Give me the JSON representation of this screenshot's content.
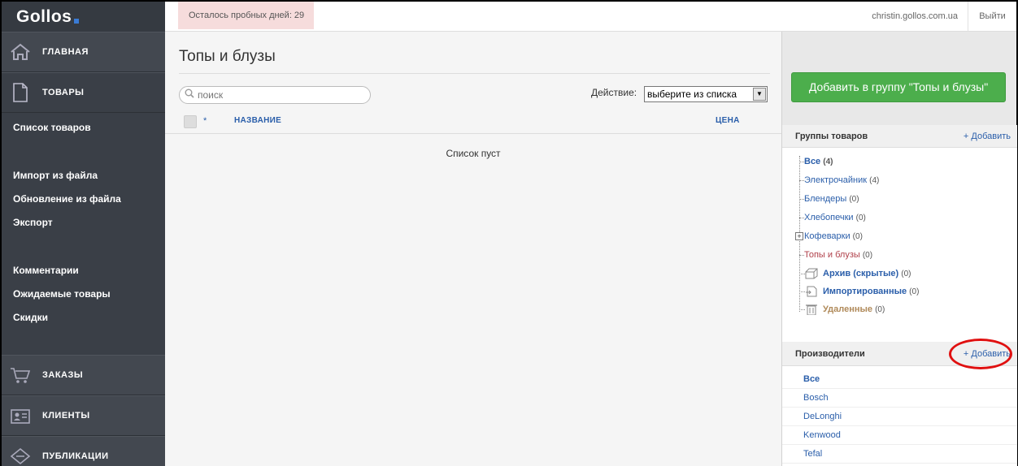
{
  "app": {
    "logo": "Gollos"
  },
  "topbar": {
    "trial_text": "Осталось пробных дней: 29",
    "user": "christin.gollos.com.ua",
    "logout": "Выйти"
  },
  "sidebar": {
    "main_items": [
      {
        "label": "ГЛАВНАЯ",
        "icon": "home-icon"
      },
      {
        "label": "ТОВАРЫ",
        "icon": "document-icon"
      }
    ],
    "sub_items_1": [
      "Список товаров"
    ],
    "sub_items_2": [
      "Импорт из файла",
      "Обновление из файла",
      "Экспорт"
    ],
    "sub_items_3": [
      "Комментарии",
      "Ожидаемые товары",
      "Скидки"
    ],
    "bottom_items": [
      {
        "label": "ЗАКАЗЫ",
        "icon": "cart-icon"
      },
      {
        "label": "КЛИЕНТЫ",
        "icon": "clients-icon"
      },
      {
        "label": "ПУБЛИКАЦИИ",
        "icon": "publications-icon"
      }
    ]
  },
  "main": {
    "title": "Топы и блузы",
    "search_placeholder": "поиск",
    "action_label": "Действие:",
    "action_select": "выберите из списка",
    "columns": {
      "star": "*",
      "name": "НАЗВАНИЕ",
      "price": "ЦЕНА"
    },
    "empty_text": "Список пуст"
  },
  "right": {
    "add_group_button": "Добавить в группу \"Топы и блузы\"",
    "groups": {
      "title": "Группы товаров",
      "add": "+ Добавить",
      "items": [
        {
          "label": "Все",
          "count": "(4)"
        },
        {
          "label": "Электрочайник",
          "count": "(4)"
        },
        {
          "label": "Блендеры",
          "count": "(0)"
        },
        {
          "label": "Хлебопечки",
          "count": "(0)"
        },
        {
          "label": "Кофеварки",
          "count": "(0)"
        },
        {
          "label": "Топы и блузы",
          "count": "(0)"
        }
      ],
      "system": [
        {
          "label": "Архив (скрытые)",
          "count": "(0)",
          "icon": "archive-box-icon"
        },
        {
          "label": "Импортированные",
          "count": "(0)",
          "icon": "imported-icon"
        },
        {
          "label": "Удаленные",
          "count": "(0)",
          "icon": "trash-icon"
        }
      ]
    },
    "makers": {
      "title": "Производители",
      "add": "+ Добавить",
      "items": [
        "Все",
        "Bosch",
        "DeLonghi",
        "Kenwood",
        "Tefal"
      ]
    }
  },
  "colors": {
    "accent_green": "#4cae4c",
    "link_blue": "#2a5eaa",
    "sidebar": "#3a3f47",
    "annotation_red": "#e01010"
  }
}
